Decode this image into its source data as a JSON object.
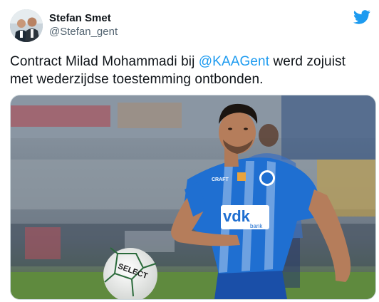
{
  "author": {
    "display_name": "Stefan Smet",
    "handle": "@Stefan_gent",
    "avatar_icon": "profile-photo"
  },
  "brand": {
    "icon": "twitter-bird-icon",
    "color": "#1d9bf0"
  },
  "tweet": {
    "text_before": "Contract Milad Mohammadi bij ",
    "mention": "@KAAGent",
    "text_after": " werd zojuist met wederzijdse toestemming ontbonden."
  },
  "photo": {
    "jersey_sponsor": "vdk",
    "jersey_sponsor_sub": "bank",
    "jersey_brand": "CRAFT",
    "ball_brand": "SELECT"
  },
  "colors": {
    "jersey_blue": "#1f6fd1",
    "pitch_green": "#5f8a3e",
    "mention_blue": "#1d9bf0"
  }
}
